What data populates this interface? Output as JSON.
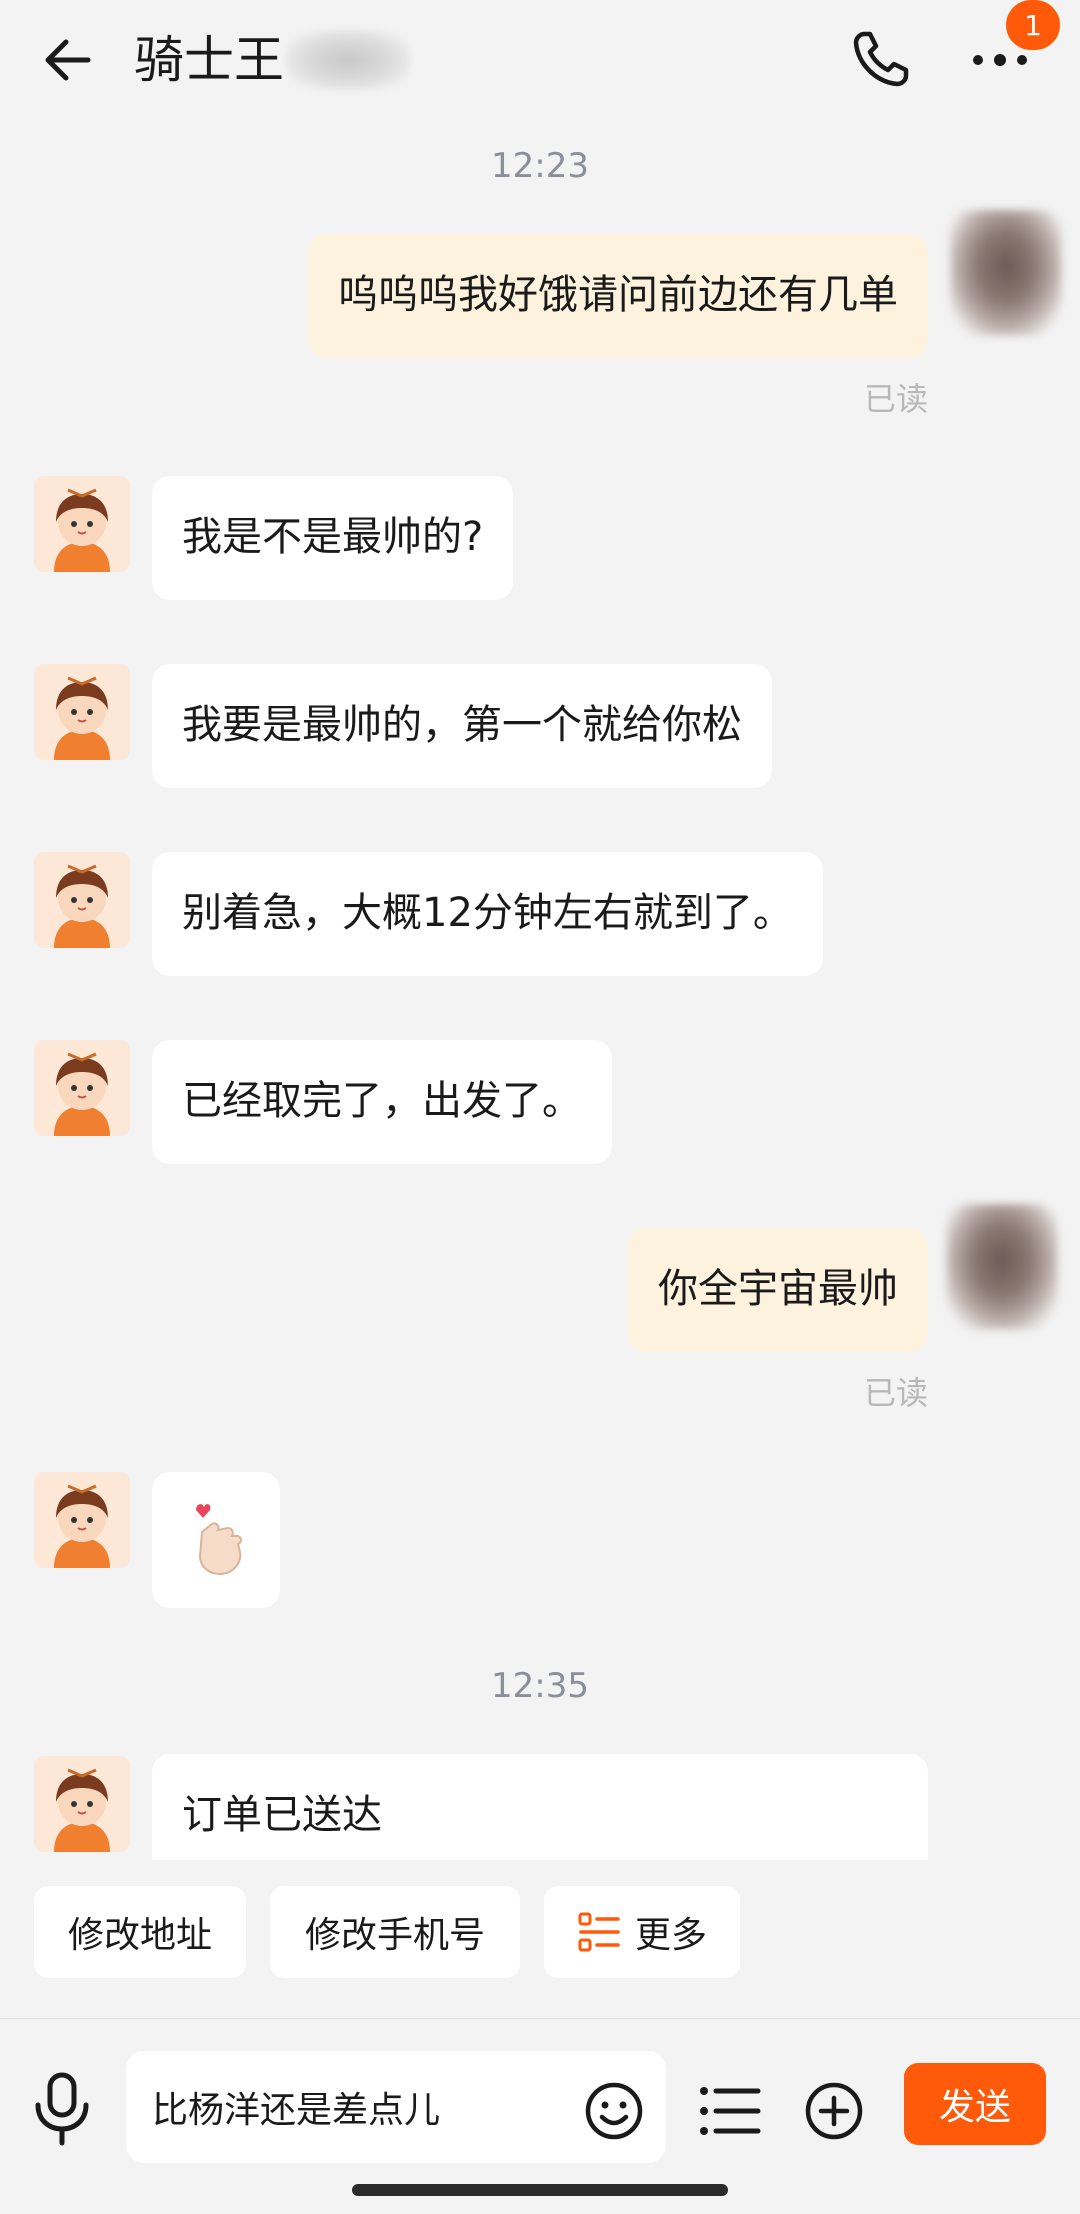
{
  "header": {
    "title": "骑士王",
    "badge_count": "1",
    "icons": [
      "arrow-left-icon",
      "phone-icon",
      "more-dots-icon"
    ]
  },
  "messages": [
    {
      "type": "time",
      "text": "12:23"
    },
    {
      "type": "out",
      "text": "呜呜呜我好饿请问前边还有几单",
      "status": "已读"
    },
    {
      "type": "in",
      "text": "我是不是最帅的?"
    },
    {
      "type": "in",
      "text": "我要是最帅的，第一个就给你松"
    },
    {
      "type": "in",
      "text": "别着急，大概12分钟左右就到了。"
    },
    {
      "type": "in",
      "text": "已经取完了，出发了。"
    },
    {
      "type": "out",
      "text": "你全宇宙最帅",
      "status": "已读"
    },
    {
      "type": "in-sticker",
      "sticker": "finger-heart-icon"
    },
    {
      "type": "time",
      "text": "12:35"
    },
    {
      "type": "in",
      "text": "订单已送达"
    }
  ],
  "quick_actions": {
    "modify_address": "修改地址",
    "modify_phone": "修改手机号",
    "more": "更多"
  },
  "input": {
    "value": "比杨洋还是差点儿",
    "send_label": "发送"
  },
  "colors": {
    "accent": "#ff5a0a",
    "outgoing_bubble": "#fdf2dd",
    "incoming_bubble": "#ffffff",
    "background": "#f3f3f3"
  }
}
